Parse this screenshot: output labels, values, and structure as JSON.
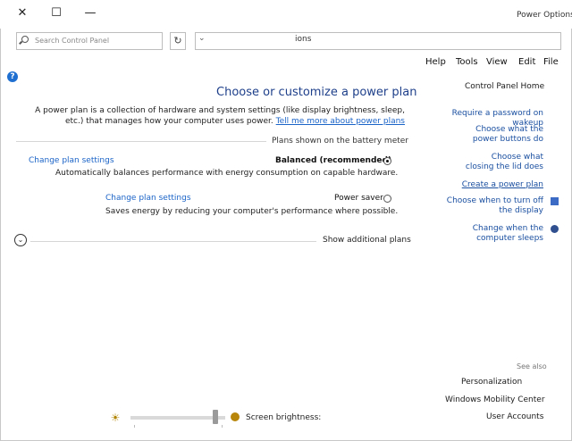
{
  "window": {
    "title": "Power Options",
    "controls": [
      "✕",
      "☐",
      "—"
    ]
  },
  "address": {
    "search_placeholder": "Search Control Panel",
    "path_fragment": "ions",
    "refresh": "↻",
    "caret": "⌄"
  },
  "menu": {
    "items": [
      "File",
      "Edit",
      "View",
      "Tools",
      "Help"
    ]
  },
  "help_glyph": "?",
  "main": {
    "title": "Choose or customize a power plan",
    "desc": "A power plan is a collection of hardware and system settings (like display brightness, sleep, etc.) that manages how your computer uses power.",
    "desc_link": "Tell me more about power plans",
    "section_label": "Plans shown on the battery meter",
    "plans": [
      {
        "name": "Balanced (recommended)",
        "desc": "Automatically balances performance with energy consumption on capable hardware.",
        "change": "Change plan settings",
        "selected": true
      },
      {
        "name": "Power saver",
        "desc": "Saves energy by reducing your computer's performance where possible.",
        "change": "Change plan settings",
        "selected": false
      }
    ],
    "show_additional": "Show additional plans"
  },
  "sidebar": {
    "home": "Control Panel Home",
    "links": [
      "Require a password on wakeup",
      "Choose what the power buttons do",
      "Choose what closing the lid does",
      "Create a power plan",
      "Choose when to turn off the display",
      "Change when the computer sleeps"
    ],
    "see_also_label": "See also",
    "see_also": [
      "Personalization",
      "Windows Mobility Center",
      "User Accounts"
    ]
  },
  "brightness": {
    "label": "Screen brightness:",
    "level": 0.9
  }
}
